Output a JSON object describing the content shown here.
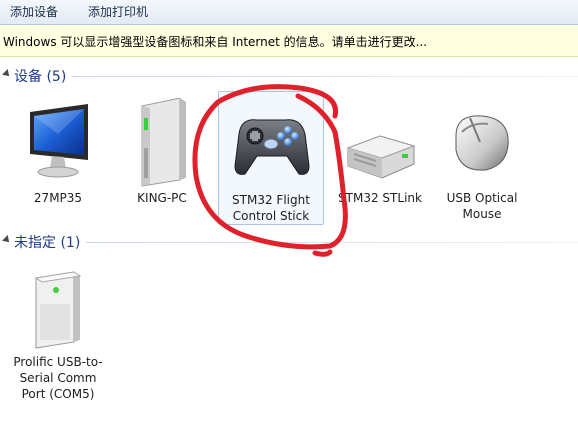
{
  "toolbar": {
    "add_device": "添加设备",
    "add_printer": "添加打印机"
  },
  "infobar": {
    "text": "Windows 可以显示增强型设备图标和来自 Internet 的信息。请单击进行更改..."
  },
  "groups": {
    "devices": {
      "title": "设备 (5)",
      "items": [
        {
          "label": "27MP35",
          "icon": "monitor-icon"
        },
        {
          "label": "KING-PC",
          "icon": "computer-tower-icon"
        },
        {
          "label": "STM32 Flight Control Stick",
          "icon": "gamepad-icon"
        },
        {
          "label": "STM32 STLink",
          "icon": "external-drive-icon"
        },
        {
          "label": "USB Optical Mouse",
          "icon": "mouse-icon"
        }
      ]
    },
    "unspecified": {
      "title": "未指定 (1)",
      "items": [
        {
          "label": "Prolific USB-to-Serial Comm Port (COM5)",
          "icon": "device-box-icon"
        }
      ]
    }
  },
  "colors": {
    "annotation": "#e0202a",
    "group_title": "#1e3a8a",
    "infobar_bg": "#ffffe1"
  }
}
